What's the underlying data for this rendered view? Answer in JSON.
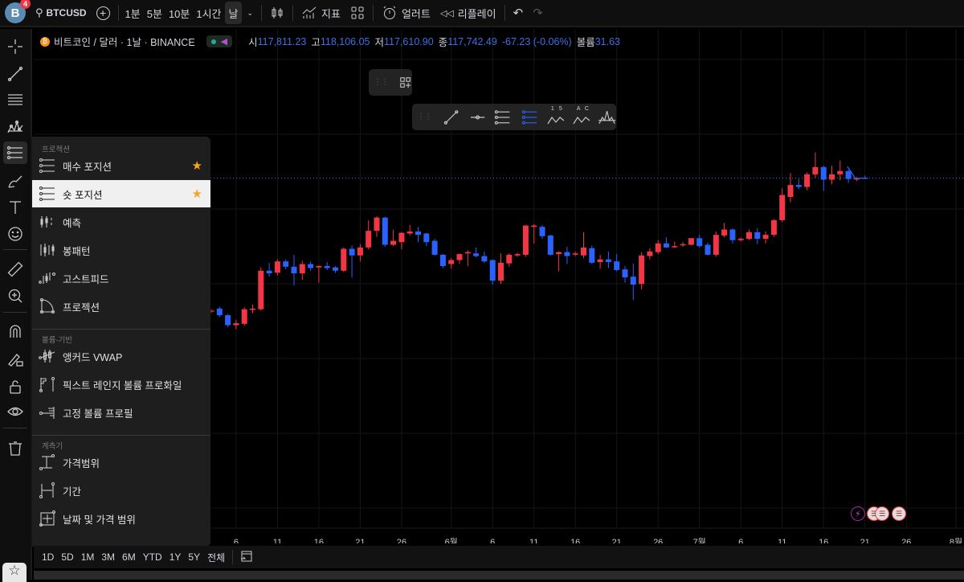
{
  "topbar": {
    "avatar_letter": "B",
    "notification_count": "4",
    "symbol": "BTCUSD",
    "timeframes": [
      "1분",
      "5분",
      "10분",
      "1시간",
      "날"
    ],
    "active_timeframe": "날",
    "indicators_label": "지표",
    "alert_label": "얼러트",
    "replay_label": "리플레이"
  },
  "legend": {
    "title": "비트코인 / 달러 · 1날 · BINANCE",
    "open_label": "시",
    "open": "117,811.23",
    "high_label": "고",
    "high": "118,106.05",
    "low_label": "저",
    "low": "117,610.90",
    "close_label": "종",
    "close": "117,742.49",
    "change": "-67.23 (-0.06%)",
    "volume_label": "볼륨",
    "volume": "31.63"
  },
  "colors": {
    "up": "#f23645",
    "down": "#2962ff",
    "accent": "#2962ff",
    "star": "#f5a623"
  },
  "floating_toolbar": {
    "fib_labels": [
      "1",
      "5",
      "A",
      "C"
    ]
  },
  "menu": {
    "sections": [
      {
        "header": "프로젝션",
        "items": [
          {
            "label": "매수 포지션",
            "icon": "long-position-icon",
            "favorite": true
          },
          {
            "label": "숏 포지션",
            "icon": "short-position-icon",
            "favorite": true,
            "selected": true
          },
          {
            "label": "예측",
            "icon": "forecast-icon"
          },
          {
            "label": "봉패턴",
            "icon": "bars-pattern-icon"
          },
          {
            "label": "고스트피드",
            "icon": "ghost-feed-icon"
          },
          {
            "label": "프로젝션",
            "icon": "projection-icon"
          }
        ]
      },
      {
        "header": "볼륨-기반",
        "items": [
          {
            "label": "앵커드 VWAP",
            "icon": "anchored-vwap-icon"
          },
          {
            "label": "픽스트 레인지 볼륨 프로화일",
            "icon": "fixed-range-volume-icon"
          },
          {
            "label": "고정 볼륨 프로필",
            "icon": "fixed-volume-profile-icon"
          }
        ]
      },
      {
        "header": "계측기",
        "items": [
          {
            "label": "가격범위",
            "icon": "price-range-icon"
          },
          {
            "label": "기간",
            "icon": "date-range-icon"
          },
          {
            "label": "날짜 및 가격 범위",
            "icon": "date-price-range-icon"
          }
        ]
      }
    ]
  },
  "range_buttons": [
    "1D",
    "5D",
    "1M",
    "3M",
    "6M",
    "YTD",
    "1Y",
    "5Y",
    "전체"
  ],
  "chart_data": {
    "type": "candlestick",
    "start_date": "05-03",
    "ylim": [
      65.3,
      139.7
    ],
    "units": "thousand USD",
    "last_price": 117.74,
    "candles_ohlc": [
      [
        97.7,
        98.0,
        97.4,
        97.8
      ],
      [
        98.1,
        98.4,
        96.8,
        97.1
      ],
      [
        97.1,
        97.3,
        95.3,
        95.6
      ],
      [
        95.6,
        96.4,
        95.0,
        95.9
      ],
      [
        95.8,
        98.3,
        95.5,
        98.0
      ],
      [
        97.9,
        98.7,
        97.4,
        98.1
      ],
      [
        98.0,
        104.3,
        97.8,
        103.8
      ],
      [
        103.8,
        105.0,
        102.9,
        103.4
      ],
      [
        103.5,
        105.5,
        103.1,
        105.2
      ],
      [
        105.2,
        105.5,
        104.0,
        104.4
      ],
      [
        104.4,
        106.2,
        101.6,
        103.4
      ],
      [
        103.4,
        105.3,
        102.4,
        104.8
      ],
      [
        104.8,
        105.2,
        103.8,
        104.2
      ],
      [
        104.3,
        104.6,
        102.0,
        104.5
      ],
      [
        104.5,
        105.1,
        103.9,
        104.2
      ],
      [
        104.3,
        104.5,
        103.5,
        103.8
      ],
      [
        103.8,
        107.3,
        103.6,
        107.1
      ],
      [
        107.1,
        107.6,
        102.8,
        106.1
      ],
      [
        106.1,
        107.8,
        105.2,
        107.3
      ],
      [
        107.3,
        111.4,
        107.0,
        109.8
      ],
      [
        109.8,
        112.0,
        108.9,
        111.8
      ],
      [
        111.8,
        111.9,
        107.4,
        107.7
      ],
      [
        107.7,
        110.0,
        107.5,
        108.3
      ],
      [
        108.1,
        109.6,
        107.0,
        109.5
      ],
      [
        109.4,
        110.7,
        109.1,
        109.7
      ],
      [
        109.7,
        110.4,
        108.1,
        109.2
      ],
      [
        109.4,
        109.5,
        107.5,
        108.1
      ],
      [
        108.3,
        108.6,
        106.1,
        106.2
      ],
      [
        106.2,
        106.3,
        104.2,
        104.5
      ],
      [
        104.8,
        105.7,
        104.1,
        105.4
      ],
      [
        105.4,
        106.4,
        104.8,
        106.3
      ],
      [
        106.4,
        106.9,
        104.5,
        106.6
      ],
      [
        106.4,
        107.3,
        105.8,
        106.0
      ],
      [
        106.0,
        106.7,
        105.0,
        105.2
      ],
      [
        105.4,
        105.5,
        101.7,
        102.3
      ],
      [
        102.3,
        106.4,
        101.8,
        105.0
      ],
      [
        104.9,
        106.4,
        104.4,
        106.2
      ],
      [
        106.1,
        106.5,
        105.9,
        106.3
      ],
      [
        106.2,
        110.7,
        105.9,
        110.6
      ],
      [
        110.4,
        110.8,
        107.9,
        110.6
      ],
      [
        110.4,
        110.7,
        108.6,
        109.0
      ],
      [
        109.1,
        109.2,
        106.1,
        106.2
      ],
      [
        106.3,
        106.7,
        103.7,
        106.6
      ],
      [
        106.6,
        107.4,
        104.8,
        106.0
      ],
      [
        106.3,
        106.7,
        106.0,
        106.4
      ],
      [
        106.1,
        109.6,
        105.7,
        107.3
      ],
      [
        107.2,
        107.6,
        104.8,
        105.0
      ],
      [
        105.1,
        106.2,
        104.1,
        105.5
      ],
      [
        105.5,
        106.7,
        104.2,
        105.1
      ],
      [
        105.2,
        106.3,
        103.7,
        103.9
      ],
      [
        104.0,
        104.5,
        102.0,
        102.8
      ],
      [
        102.9,
        104.9,
        99.4,
        101.7
      ],
      [
        101.8,
        106.6,
        101.0,
        106.1
      ],
      [
        106.0,
        107.2,
        105.5,
        106.7
      ],
      [
        106.6,
        108.4,
        106.3,
        107.9
      ],
      [
        107.9,
        108.8,
        107.2,
        107.3
      ],
      [
        107.4,
        108.2,
        107.2,
        107.5
      ],
      [
        107.7,
        108.1,
        107.4,
        107.8
      ],
      [
        107.7,
        108.7,
        107.6,
        108.7
      ],
      [
        108.7,
        109.2,
        107.3,
        107.5
      ],
      [
        107.7,
        108.0,
        106.1,
        106.2
      ],
      [
        106.2,
        109.7,
        105.9,
        109.2
      ],
      [
        109.1,
        111.0,
        108.8,
        110.0
      ],
      [
        110.0,
        110.2,
        107.9,
        108.4
      ],
      [
        108.4,
        108.8,
        108.2,
        108.6
      ],
      [
        108.6,
        110.0,
        108.4,
        109.6
      ],
      [
        109.6,
        110.2,
        107.8,
        108.6
      ],
      [
        108.6,
        109.7,
        107.9,
        109.2
      ],
      [
        109.2,
        111.6,
        108.9,
        111.4
      ],
      [
        111.4,
        116.2,
        111.1,
        115.2
      ],
      [
        114.9,
        118.5,
        114.1,
        116.7
      ],
      [
        116.7,
        117.6,
        116.1,
        116.4
      ],
      [
        116.4,
        118.6,
        115.9,
        118.3
      ],
      [
        118.3,
        121.6,
        117.8,
        119.4
      ],
      [
        119.4,
        119.6,
        115.8,
        117.5
      ],
      [
        117.5,
        119.6,
        116.8,
        118.3
      ],
      [
        118.3,
        120.4,
        117.4,
        118.8
      ],
      [
        118.8,
        119.0,
        117.0,
        117.6
      ],
      [
        117.6,
        117.9,
        117.3,
        117.7
      ],
      [
        117.81,
        118.11,
        117.61,
        117.74
      ]
    ],
    "x_tick_labels": [
      {
        "label": "6",
        "day": 3
      },
      {
        "label": "11",
        "day": 8
      },
      {
        "label": "16",
        "day": 13
      },
      {
        "label": "21",
        "day": 18
      },
      {
        "label": "26",
        "day": 23
      },
      {
        "label": "6월",
        "day": 29
      },
      {
        "label": "6",
        "day": 34
      },
      {
        "label": "11",
        "day": 39
      },
      {
        "label": "16",
        "day": 44
      },
      {
        "label": "21",
        "day": 49
      },
      {
        "label": "26",
        "day": 54
      },
      {
        "label": "7월",
        "day": 59
      },
      {
        "label": "6",
        "day": 64
      },
      {
        "label": "11",
        "day": 69
      },
      {
        "label": "16",
        "day": 74
      },
      {
        "label": "21",
        "day": 79
      },
      {
        "label": "26",
        "day": 84
      },
      {
        "label": "8월",
        "day": 90
      }
    ]
  }
}
